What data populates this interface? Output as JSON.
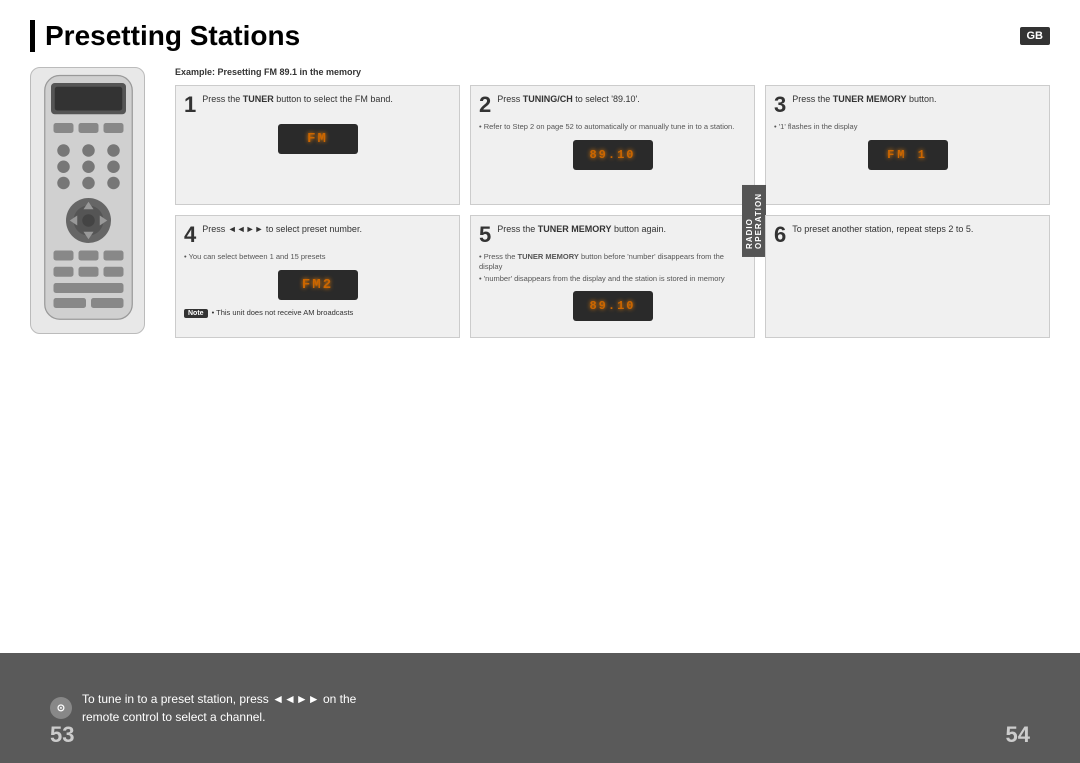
{
  "title": "Presetting Stations",
  "gb_label": "GB",
  "example_label": "Example: Presetting FM 89.1 in the memory",
  "steps": [
    {
      "number": "1",
      "instruction_parts": [
        "Press the ",
        "TUNER",
        " button to select the FM band."
      ],
      "has_bold": [
        "TUNER"
      ],
      "display": "FM",
      "notes": [],
      "note_label": "",
      "note_text": ""
    },
    {
      "number": "2",
      "instruction_parts": [
        "Press ",
        "TUNING/CH",
        " to select ’89.10’."
      ],
      "has_bold": [
        "TUNING/CH"
      ],
      "display": "89.10",
      "notes": [
        "Refer to Step 2 on page 52 to automatically or manually tune in to a station."
      ],
      "note_label": "",
      "note_text": ""
    },
    {
      "number": "3",
      "instruction_parts": [
        "Press the ",
        "TUNER MEMORY",
        " button."
      ],
      "has_bold": [
        "TUNER MEMORY"
      ],
      "display": "FM 1",
      "notes": [
        "‘1’ flashes in the display"
      ],
      "note_label": "",
      "note_text": ""
    },
    {
      "number": "4",
      "instruction_parts": [
        "Press ◄◄►► to select preset number."
      ],
      "has_bold": [],
      "display": "FM2",
      "notes": [
        "You can select between 1 and 15 presets"
      ],
      "note_label": "Note",
      "note_text": "This unit does not receive AM broadcasts"
    },
    {
      "number": "5",
      "instruction_parts": [
        "Press the ",
        "TUNER MEMORY",
        " button again."
      ],
      "has_bold": [
        "TUNER MEMORY"
      ],
      "display": "89.10",
      "notes": [
        "Press the TUNER MEMORY button before ‘number’ disappears from the display",
        "‘number’ disappears from the display and the station is stored in memory"
      ],
      "note_label": "",
      "note_text": ""
    },
    {
      "number": "6",
      "instruction_parts": [
        "To preset another station, repeat steps 2 to 5."
      ],
      "has_bold": [],
      "display": null,
      "notes": [],
      "note_label": "",
      "note_text": ""
    }
  ],
  "radio_tab": "RADIO OPERATION",
  "bottom_text_line1": "To tune in to a preset station, press ◄◄►► on the",
  "bottom_text_line2": "remote control to select a channel.",
  "page_left": "53",
  "page_right": "54"
}
